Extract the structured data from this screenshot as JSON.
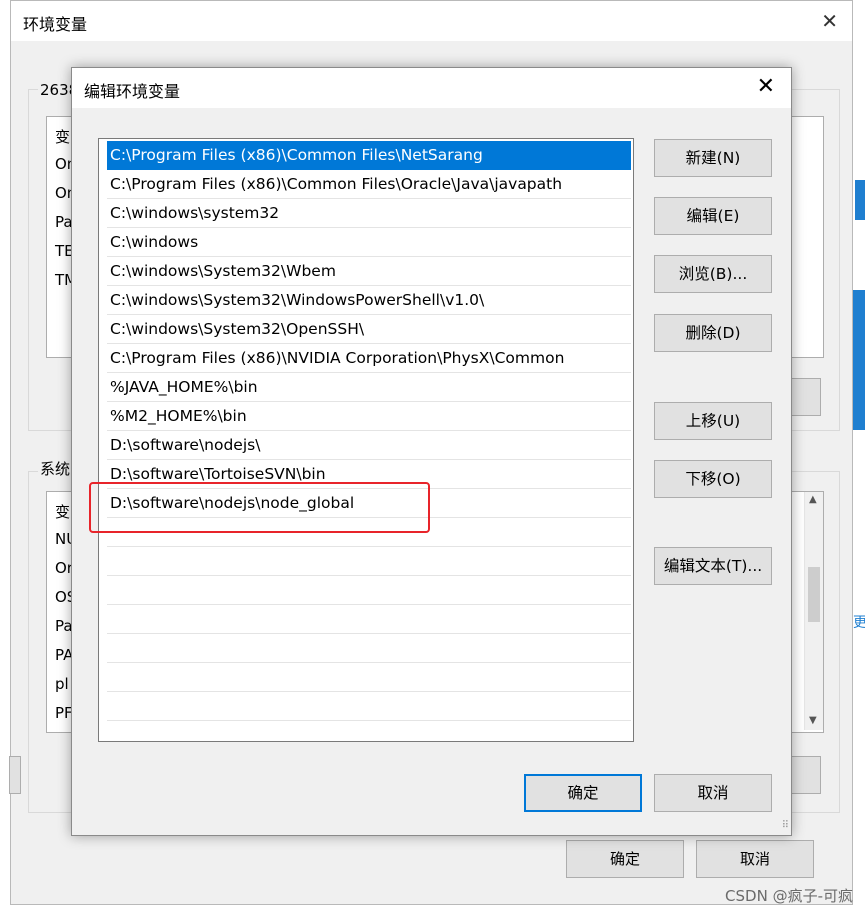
{
  "background_window": {
    "title": "环境变量",
    "close_glyph": "✕",
    "user_group_label": "2638",
    "user_list_items": [
      "变",
      "On",
      "On",
      "Pa",
      "TE",
      "TM"
    ],
    "system_group_label": "系统",
    "system_list_items": [
      "变",
      "NU",
      "Or",
      "OS",
      "Pa",
      "PA",
      "pl",
      "PF"
    ],
    "ok_label": "确定",
    "cancel_label": "取消",
    "side_text": "更"
  },
  "dialog": {
    "title": "编辑环境变量",
    "close_glyph": "✕",
    "paths": [
      "C:\\Program Files (x86)\\Common Files\\NetSarang",
      "C:\\Program Files (x86)\\Common Files\\Oracle\\Java\\javapath",
      "C:\\windows\\system32",
      "C:\\windows",
      "C:\\windows\\System32\\Wbem",
      "C:\\windows\\System32\\WindowsPowerShell\\v1.0\\",
      "C:\\windows\\System32\\OpenSSH\\",
      "C:\\Program Files (x86)\\NVIDIA Corporation\\PhysX\\Common",
      "%JAVA_HOME%\\bin",
      "%M2_HOME%\\bin",
      "D:\\software\\nodejs\\",
      "D:\\software\\TortoiseSVN\\bin",
      "D:\\software\\nodejs\\node_global"
    ],
    "selected_index": 0,
    "buttons": {
      "new": "新建(N)",
      "edit": "编辑(E)",
      "browse": "浏览(B)...",
      "delete": "删除(D)",
      "move_up": "上移(U)",
      "move_down": "下移(O)",
      "edit_text": "编辑文本(T)...",
      "ok": "确定",
      "cancel": "取消"
    }
  },
  "watermark": "CSDN @疯子-可疯",
  "colors": {
    "selection": "#0078d7",
    "highlight_box": "#e8242a",
    "primary_border": "#0078d7"
  }
}
